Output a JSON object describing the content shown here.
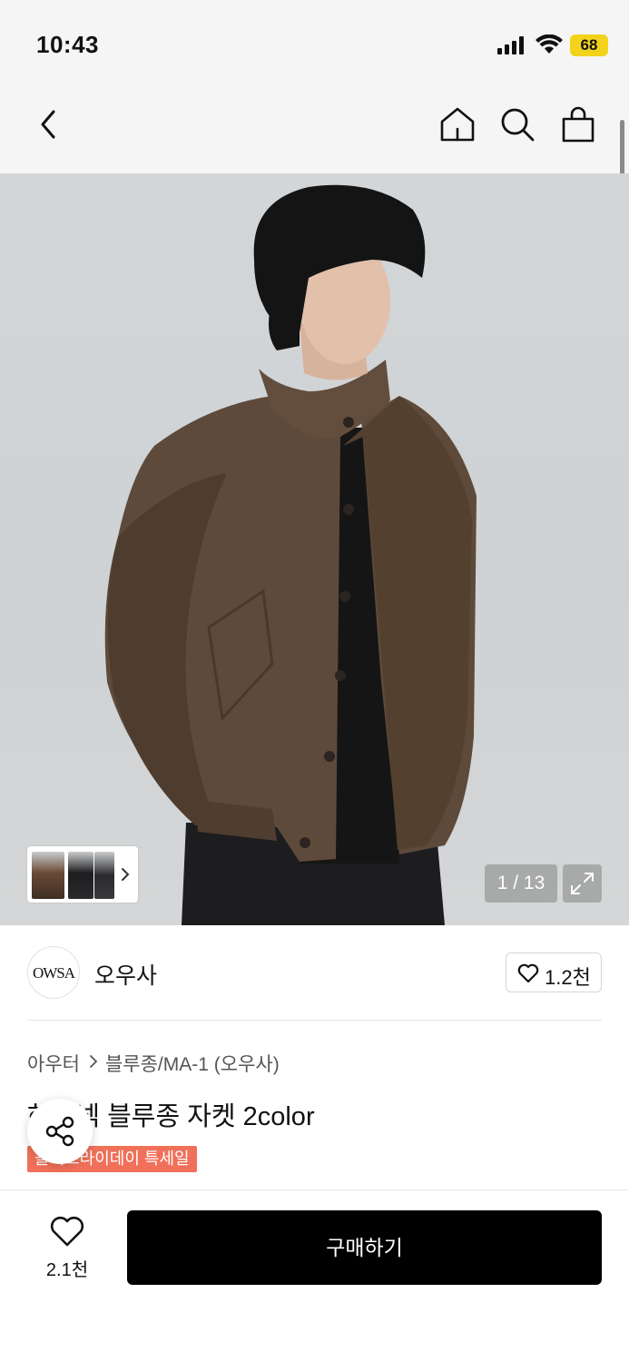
{
  "status_bar": {
    "time": "10:43",
    "battery": "68"
  },
  "gallery": {
    "counter": "1 / 13"
  },
  "brand": {
    "logo_text": "OWSA",
    "name": "오우사",
    "likes": "1.2천"
  },
  "breadcrumb": {
    "category": "아우터",
    "subcategory": "블루종/MA-1 (오우사)"
  },
  "product": {
    "title": "하이넥 블루종 자켓 2color",
    "badge": "블랙프라이데이 특세일"
  },
  "bottom_bar": {
    "wish_count": "2.1천",
    "buy_label": "구매하기"
  },
  "colors": {
    "accent_sale": "#f0705a",
    "buy_button": "#000000",
    "battery": "#f3d21b"
  }
}
